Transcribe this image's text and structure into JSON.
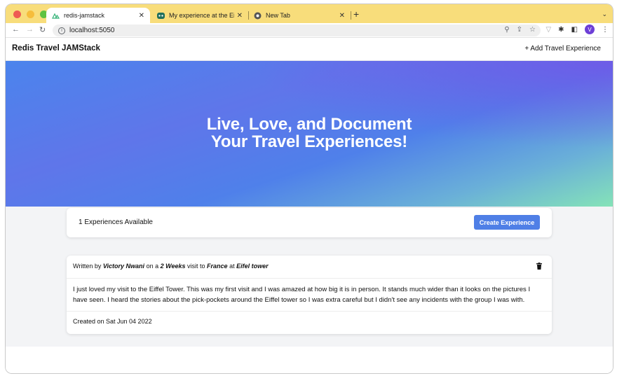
{
  "browser": {
    "tabs": [
      {
        "label": "redis-jamstack",
        "active": true
      },
      {
        "label": "My experience at the Eiffel Tow...",
        "active": false
      },
      {
        "label": "New Tab",
        "active": false
      }
    ],
    "url": "localhost:5050",
    "profile_initial": "V"
  },
  "app": {
    "brand": "Redis Travel JAMStack",
    "add_link": "+ Add Travel Experience"
  },
  "hero": {
    "line1": "Live, Love, and Document",
    "line2": "Your Travel Experiences!"
  },
  "summary": {
    "count_text": "1 Experiences Available",
    "create_button": "Create Experience"
  },
  "experience": {
    "written_by": "Written by",
    "author": "Victory Nwani",
    "on_a": "on a",
    "duration": "2 Weeks",
    "visit_to": "visit to",
    "country": "France",
    "at": "at",
    "place": "Eifel tower",
    "body": "I just loved my visit to the Eiffel Tower. This was my first visit and I was amazed at how big it is in person. It stands much wider than it looks on the pictures I have seen. I heard the stories about the pick-pockets around the Eiffel tower so I was extra careful but I didn't see any incidents with the group I was with.",
    "created": "Created on Sat Jun 04 2022"
  },
  "colors": {
    "tabstrip": "#f8dd7b",
    "accent_button": "#4f7fe6",
    "avatar": "#6d3fd6"
  }
}
